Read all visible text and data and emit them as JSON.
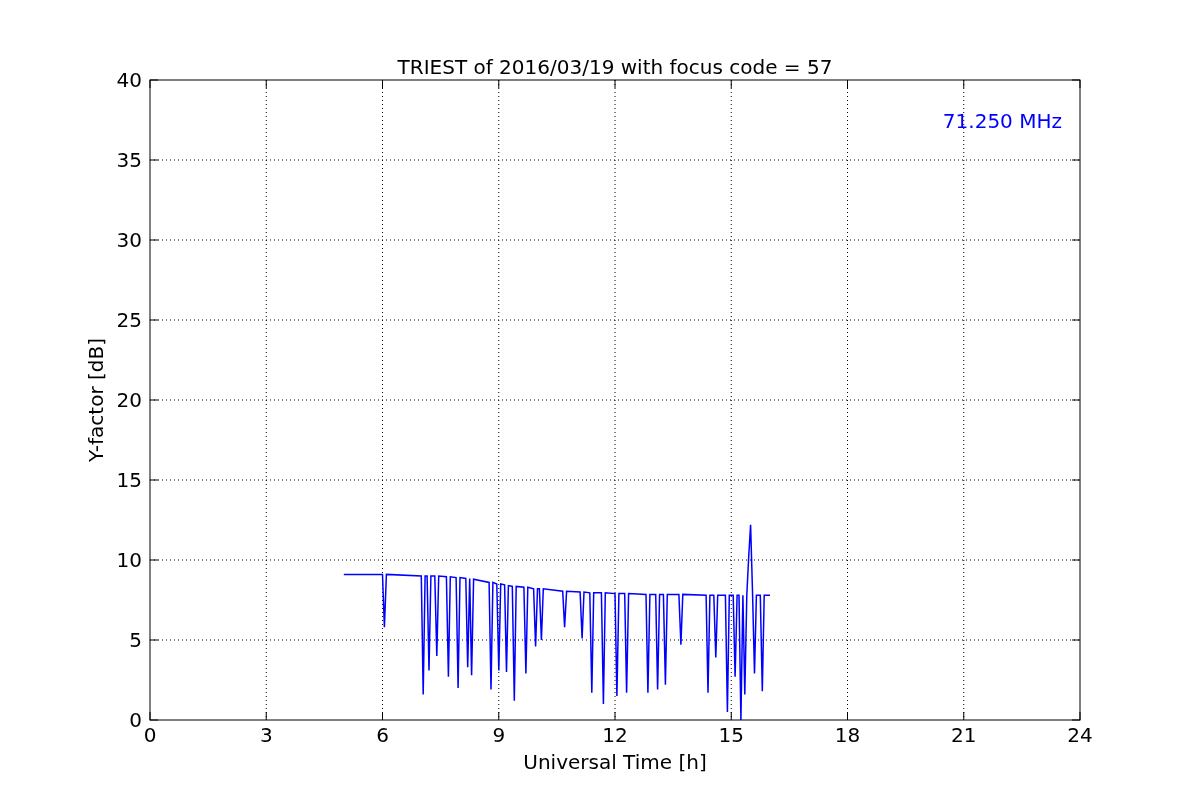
{
  "chart_data": {
    "type": "line",
    "title": "TRIEST of 2016/03/19 with focus code = 57",
    "xlabel": "Universal Time [h]",
    "ylabel": "Y-factor [dB]",
    "grid": true,
    "xlim": [
      0,
      24
    ],
    "ylim": [
      0,
      40
    ],
    "xticks": [
      0,
      3,
      6,
      9,
      12,
      15,
      18,
      21,
      24
    ],
    "yticks": [
      0,
      5,
      10,
      15,
      20,
      25,
      30,
      35,
      40
    ],
    "x": [
      5.0,
      6.0,
      6.05,
      6.1,
      7.0,
      7.05,
      7.1,
      7.15,
      7.2,
      7.25,
      7.35,
      7.4,
      7.45,
      7.65,
      7.7,
      7.75,
      7.9,
      7.95,
      8.0,
      8.15,
      8.2,
      8.25,
      8.3,
      8.35,
      8.75,
      8.8,
      8.85,
      8.95,
      9.0,
      9.05,
      9.15,
      9.2,
      9.25,
      9.35,
      9.4,
      9.45,
      9.65,
      9.7,
      9.75,
      9.9,
      9.95,
      10.0,
      10.05,
      10.1,
      10.15,
      10.65,
      10.7,
      10.75,
      11.1,
      11.15,
      11.2,
      11.35,
      11.4,
      11.45,
      11.65,
      11.7,
      11.75,
      12.0,
      12.05,
      12.1,
      12.25,
      12.3,
      12.35,
      12.8,
      12.85,
      12.9,
      13.05,
      13.1,
      13.15,
      13.25,
      13.3,
      13.35,
      13.65,
      13.7,
      13.75,
      14.35,
      14.4,
      14.45,
      14.55,
      14.6,
      14.65,
      14.85,
      14.9,
      14.95,
      15.05,
      15.1,
      15.15,
      15.2,
      15.25,
      15.3,
      15.35,
      15.4,
      15.45,
      15.5,
      15.55,
      15.6,
      15.65,
      15.75,
      15.8,
      15.85,
      16.0
    ],
    "series": [
      {
        "color": "#0000ff",
        "values": [
          9.1,
          9.1,
          5.8,
          9.1,
          9.0,
          1.6,
          9.0,
          9.0,
          3.1,
          9.0,
          9.0,
          4.0,
          9.0,
          8.95,
          2.7,
          8.95,
          8.9,
          2.0,
          8.9,
          8.85,
          3.3,
          8.85,
          2.8,
          8.8,
          8.6,
          1.9,
          8.6,
          8.5,
          3.1,
          8.5,
          8.45,
          3.0,
          8.4,
          8.35,
          1.2,
          8.35,
          8.3,
          2.9,
          8.3,
          8.2,
          4.6,
          8.2,
          8.2,
          5.0,
          8.2,
          8.05,
          5.8,
          8.05,
          8.0,
          5.1,
          8.0,
          7.95,
          1.7,
          7.95,
          7.95,
          1.0,
          7.95,
          7.9,
          1.5,
          7.9,
          7.9,
          1.7,
          7.9,
          7.85,
          1.7,
          7.85,
          7.85,
          1.9,
          7.85,
          7.85,
          2.2,
          7.85,
          7.85,
          4.7,
          7.85,
          7.8,
          1.7,
          7.8,
          7.8,
          3.9,
          7.8,
          7.8,
          0.5,
          7.8,
          7.8,
          2.7,
          7.8,
          7.8,
          0.0,
          7.8,
          1.6,
          7.8,
          10.2,
          12.2,
          7.8,
          2.9,
          7.8,
          7.8,
          1.8,
          7.8,
          7.8
        ]
      }
    ],
    "annotations": [
      {
        "text": "71.250 MHz"
      }
    ]
  }
}
